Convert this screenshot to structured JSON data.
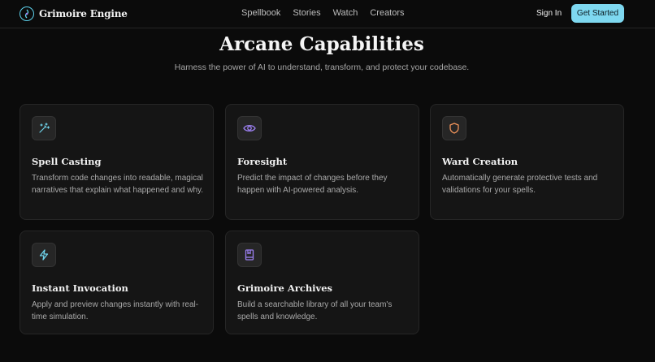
{
  "nav": {
    "brand": "Grimoire Engine",
    "links": [
      "Spellbook",
      "Stories",
      "Watch",
      "Creators"
    ],
    "sign_in": "Sign In",
    "get_started": "Get Started",
    "accent": "#7ed8f0"
  },
  "hero": {
    "title": "Arcane Capabilities",
    "subtitle": "Harness the power of AI to understand, transform, and protect your codebase."
  },
  "cards": [
    {
      "title": "Spell Casting",
      "desc": "Transform code changes into readable, magical narratives that explain what happened and why.",
      "icon": "magic-wand-icon",
      "icon_color": "#6fd4ec"
    },
    {
      "title": "Foresight",
      "desc": "Predict the impact of changes before they happen with AI-powered analysis.",
      "icon": "eye-icon",
      "icon_color": "#9b7ff0"
    },
    {
      "title": "Ward Creation",
      "desc": "Automatically generate protective tests and validations for your spells.",
      "icon": "shield-icon",
      "icon_color": "#f0935a"
    },
    {
      "title": "Instant Invocation",
      "desc": "Apply and preview changes instantly with real-time simulation.",
      "icon": "lightning-icon",
      "icon_color": "#6fd4ec"
    },
    {
      "title": "Grimoire Archives",
      "desc": "Build a searchable library of all your team's spells and knowledge.",
      "icon": "book-icon",
      "icon_color": "#9b7ff0"
    }
  ]
}
